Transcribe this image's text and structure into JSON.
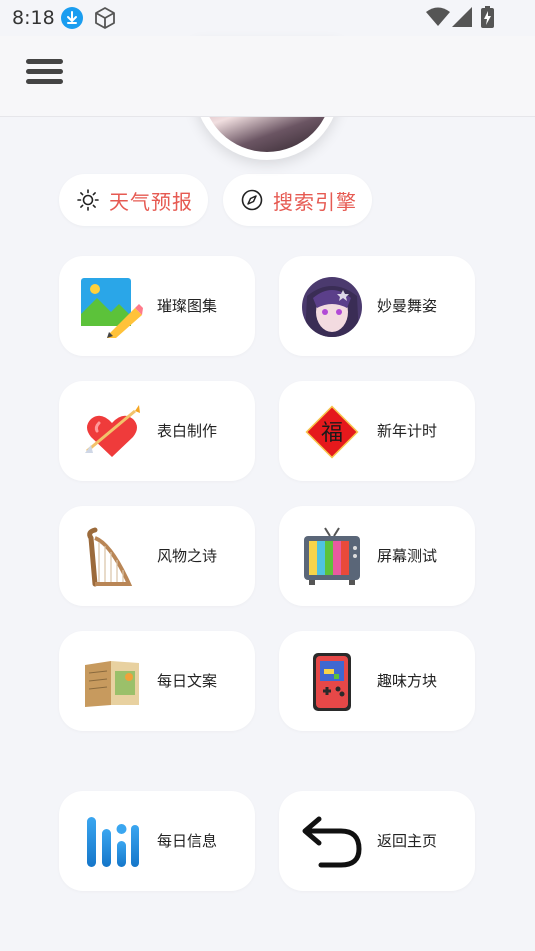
{
  "status_bar": {
    "time": "8:18",
    "icons": [
      "download-icon",
      "cube-icon",
      "wifi-icon",
      "signal-icon",
      "battery-icon"
    ]
  },
  "header": {
    "menu_icon": "menu-icon"
  },
  "quick_links": [
    {
      "label": "天气预报",
      "icon": "sun-icon"
    },
    {
      "label": "搜索引擎",
      "icon": "compass-icon"
    }
  ],
  "grid": [
    {
      "label": "璀璨图集",
      "icon": "gallery-pencil-icon"
    },
    {
      "label": "妙曼舞姿",
      "icon": "anime-avatar-icon"
    },
    {
      "label": "表白制作",
      "icon": "heart-arrow-icon"
    },
    {
      "label": "新年计时",
      "icon": "fu-character-icon"
    },
    {
      "label": "风物之诗",
      "icon": "harp-icon"
    },
    {
      "label": "屏幕测试",
      "icon": "retro-tv-icon"
    },
    {
      "label": "每日文案",
      "icon": "book-icon"
    },
    {
      "label": "趣味方块",
      "icon": "handheld-game-icon"
    },
    {
      "label": "每日信息",
      "icon": "bars-logo-icon"
    },
    {
      "label": "返回主页",
      "icon": "return-arrow-icon"
    }
  ],
  "colors": {
    "accent": "#e65a52",
    "background": "#f4f5f9",
    "card": "#ffffff"
  }
}
